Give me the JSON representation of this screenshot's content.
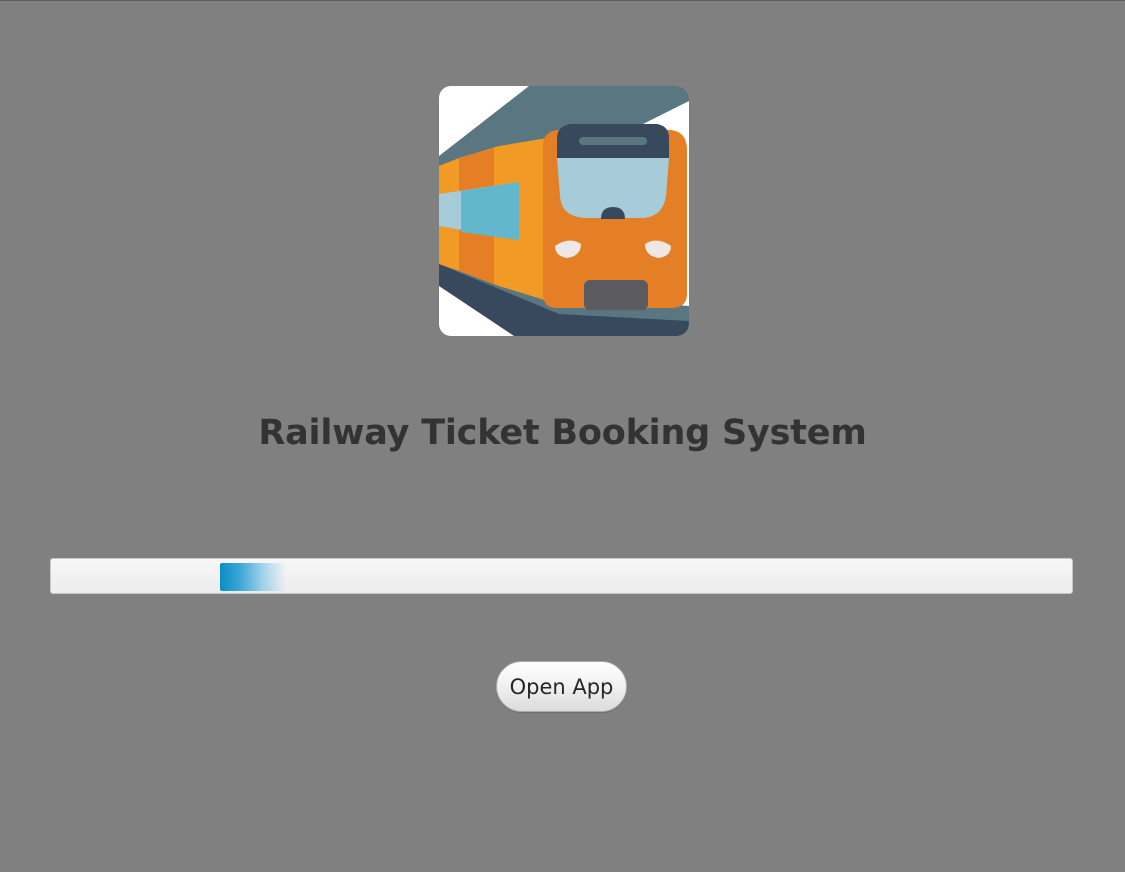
{
  "window": {
    "background_color": "#808080"
  },
  "logo": {
    "icon": "train-icon",
    "colors": {
      "body_orange": "#e57f25",
      "body_light_orange": "#f19a26",
      "roof_dark": "#38495e",
      "slate": "#5a7680",
      "window_blue": "#a5ccd8",
      "side_window_blue": "#62b7cd",
      "bumper_gray": "#5c5b60"
    }
  },
  "header": {
    "title": "Railway Ticket Booking System"
  },
  "progress": {
    "state": "indeterminate",
    "accent_color": "#0b8ec7"
  },
  "actions": {
    "open_app_label": "Open App"
  }
}
